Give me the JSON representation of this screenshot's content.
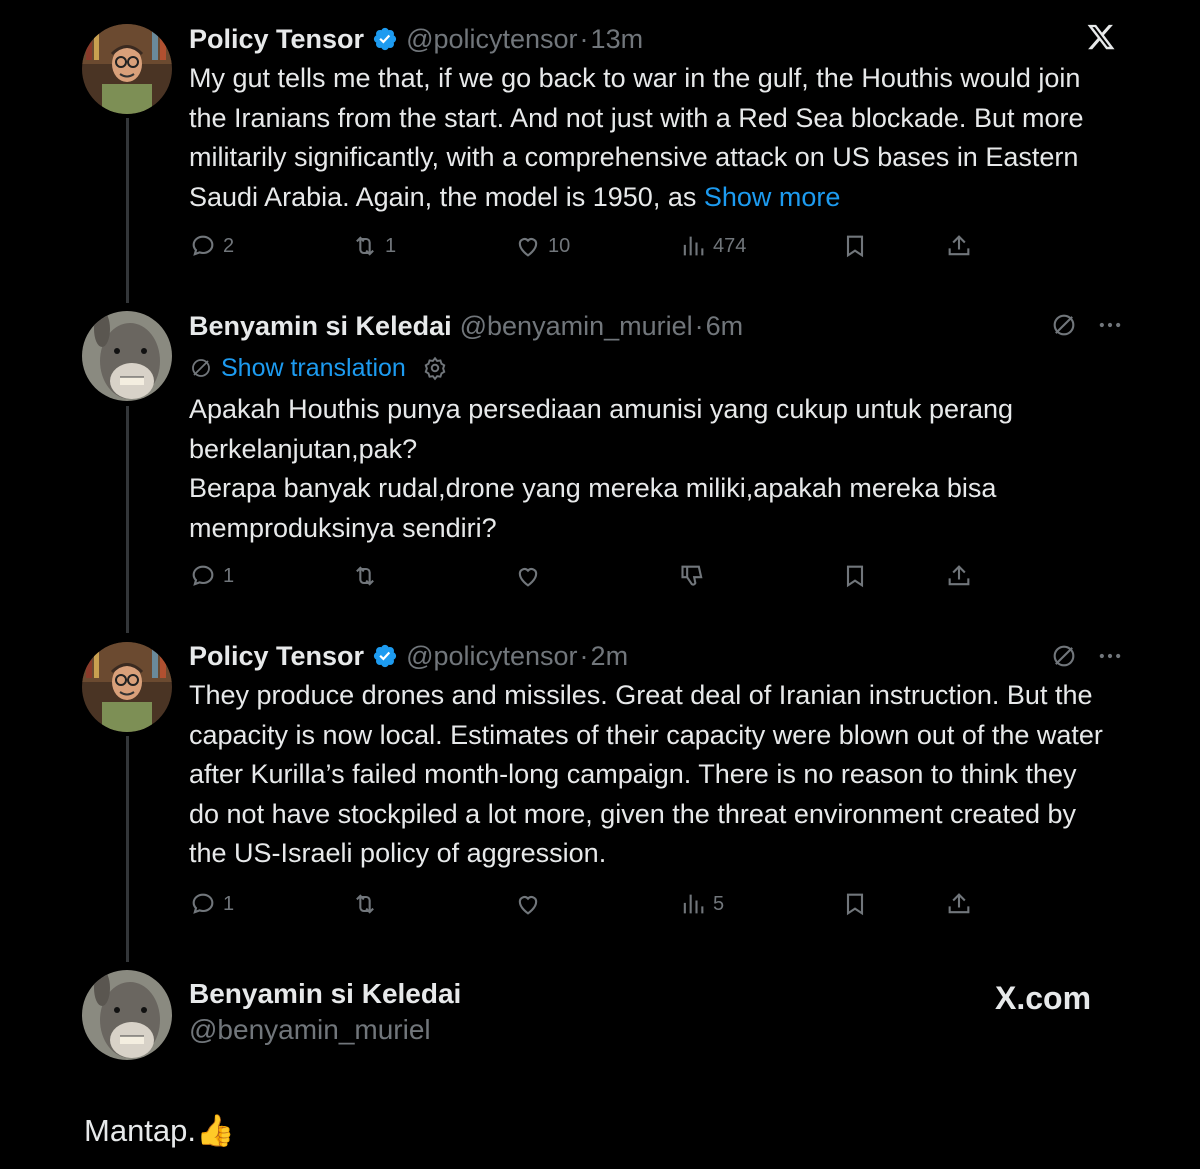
{
  "tweets": [
    {
      "name": "Policy Tensor",
      "handle": "@policytensor",
      "time": "13m",
      "text": "My gut tells me that, if we go back to war in the gulf, the Houthis would join the Iranians from the start. And not just with a Red Sea blockade. But more militarily significantly, with a comprehensive attack on US bases in Eastern Saudi Arabia. Again, the model is 1950, as ",
      "show_more": "Show more",
      "reply_count": "2",
      "retweet_count": "1",
      "like_count": "10",
      "view_count": "474"
    },
    {
      "name": "Benyamin si Keledai",
      "handle": "@benyamin_muriel",
      "time": "6m",
      "show_translation": "Show translation",
      "text": "Apakah Houthis punya persediaan amunisi yang cukup untuk perang berkelanjutan,pak?\nBerapa banyak rudal,drone yang mereka miliki,apakah mereka bisa memproduksinya sendiri?",
      "reply_count": "1"
    },
    {
      "name": "Policy Tensor",
      "handle": "@policytensor",
      "time": "2m",
      "text": "They produce drones and missiles. Great deal of Iranian instruction. But the capacity is now local. Estimates of their capacity were blown out of the water after Kurilla’s failed month-long campaign. There is no reason to think they do not have stockpiled a lot more, given the threat environment created by the US-Israeli policy of aggression.",
      "reply_count": "1",
      "view_count": "5"
    }
  ],
  "footer": {
    "name": "Benyamin si Keledai",
    "handle": "@benyamin_muriel",
    "brand": "X.com",
    "caption": "Mantap.👍"
  },
  "colors": {
    "background": "#000000",
    "text": "#e7e9ea",
    "muted": "#71767b",
    "link": "#1d9bf0",
    "verified": "#1d9bf0"
  },
  "icons": [
    "x-logo-icon",
    "verified-badge-icon",
    "reply-icon",
    "retweet-icon",
    "like-icon",
    "views-icon",
    "dislike-icon",
    "bookmark-icon",
    "share-icon",
    "grok-translate-icon",
    "more-icon",
    "gear-icon"
  ]
}
